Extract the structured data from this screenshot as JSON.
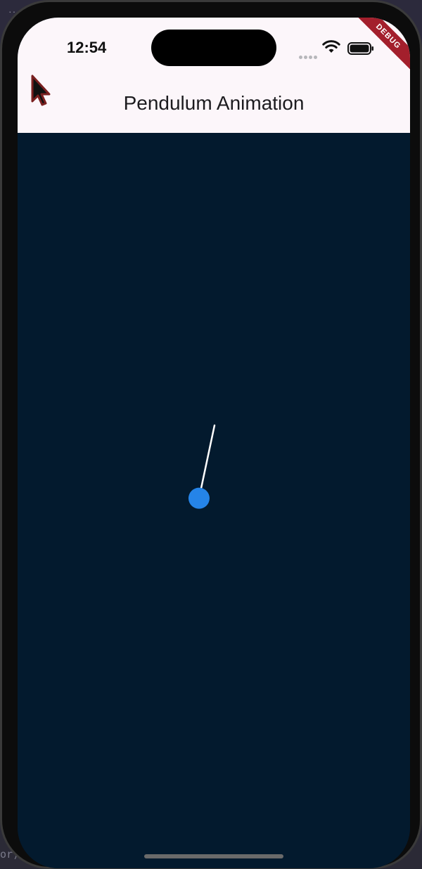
{
  "desktop": {
    "menu_dots": "···",
    "side_text": "or)"
  },
  "status_bar": {
    "time": "12:54",
    "icons": [
      "cellular-signal-icon",
      "wifi-icon",
      "battery-icon"
    ]
  },
  "debug_banner": {
    "label": "DEBUG",
    "color": "#a31f2c"
  },
  "app_bar": {
    "title": "Pendulum Animation",
    "background": "#fcf6fa"
  },
  "pendulum": {
    "background": "#031a2e",
    "string_color": "#ffffff",
    "bob_color": "#2584e8",
    "angle_degrees": 12
  },
  "cursor_icon": "arrow-cursor-icon"
}
